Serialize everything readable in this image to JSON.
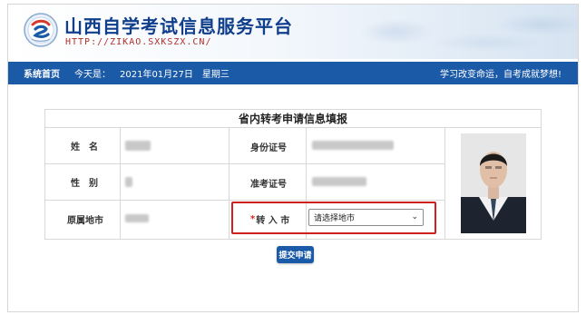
{
  "header": {
    "site_title": "山西自学考试信息服务平台",
    "site_url": "HTTP://ZIKAO.SXKSZX.CN/",
    "logo_icon": "exam-logo-icon"
  },
  "nav": {
    "home": "系统首页",
    "today_prefix": "今天是：",
    "date": "2021年01月27日",
    "weekday": "星期三",
    "slogan": "学习改变命运，自考成就梦想!"
  },
  "form": {
    "title": "省内转考申请信息填报",
    "name_label": "姓　名",
    "gender_label": "性　别",
    "origin_city_label": "原属地市",
    "id_label": "身份证号",
    "ticket_label": "准考证号",
    "transfer_city_required_mark": "*",
    "transfer_city_label": "转 入 市",
    "transfer_city_select": {
      "selected": "请选择地市"
    },
    "submit_label": "提交申请"
  },
  "colors": {
    "nav_bg": "#1b5aa7",
    "title_color": "#0f3e8c",
    "url_color": "#b0302a",
    "highlight": "#d0201c"
  }
}
